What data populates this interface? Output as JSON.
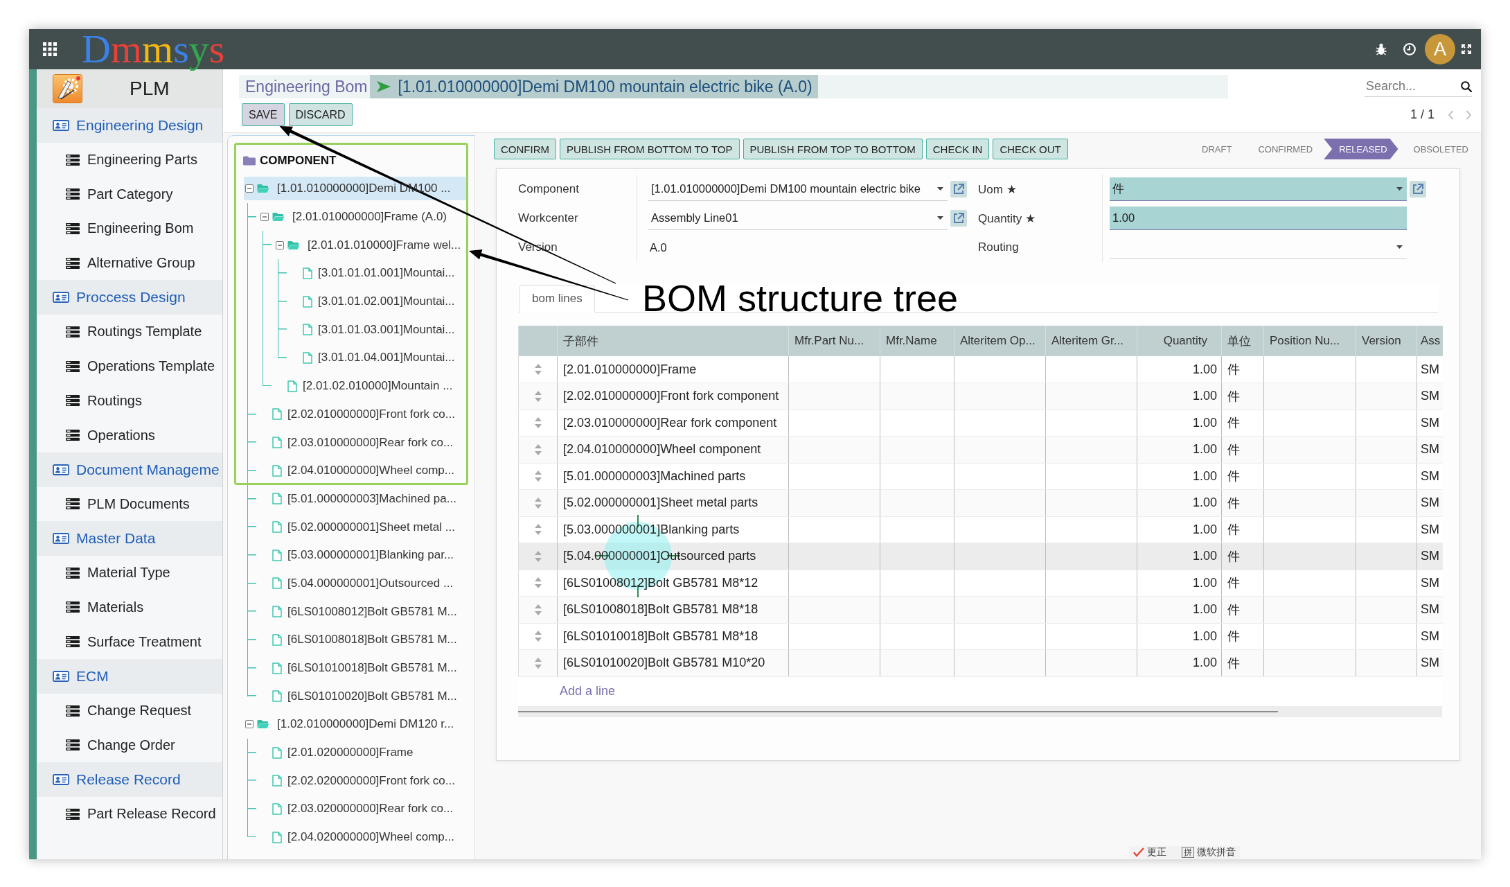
{
  "topbar": {
    "logo": "Dmmsys",
    "avatar": "A"
  },
  "sidebar": {
    "app_title": "PLM",
    "sections": [
      {
        "label": "Engineering Design",
        "children": [
          {
            "label": "Engineering Parts"
          },
          {
            "label": "Part Category"
          },
          {
            "label": "Engineering Bom"
          },
          {
            "label": "Alternative Group"
          }
        ]
      },
      {
        "label": "Proccess Design",
        "children": [
          {
            "label": "Routings Template"
          },
          {
            "label": "Operations Template"
          },
          {
            "label": "Routings"
          },
          {
            "label": "Operations"
          }
        ]
      },
      {
        "label": "Document Manageme",
        "children": [
          {
            "label": "PLM Documents"
          }
        ]
      },
      {
        "label": "Master Data",
        "children": [
          {
            "label": "Material Type"
          },
          {
            "label": "Materials"
          },
          {
            "label": "Surface Treatment"
          }
        ]
      },
      {
        "label": "ECM",
        "children": [
          {
            "label": "Change Request"
          },
          {
            "label": "Change Order"
          }
        ]
      },
      {
        "label": "Release Record",
        "children": [
          {
            "label": "Part Release Record"
          }
        ]
      }
    ]
  },
  "breadcrumb": [
    {
      "label": "Engineering Bom",
      "selected": false
    },
    {
      "label": "[1.01.010000000]Demi DM100 mountain electric bike (A.0)",
      "selected": true
    }
  ],
  "search": {
    "placeholder": "Search..."
  },
  "edit_buttons": [
    {
      "label": "SAVE",
      "kind": "save"
    },
    {
      "label": "DISCARD",
      "kind": "discard"
    }
  ],
  "pager": "1 / 1",
  "tree": {
    "header": "COMPONENT",
    "nodes": [
      {
        "label": "[1.01.010000000]Demi DM100 ...",
        "selected": true,
        "expanded": true,
        "children": [
          {
            "label": "[2.01.010000000]Frame (A.0)",
            "selected": false,
            "expanded": true,
            "children": [
              {
                "label": "[2.01.01.010000]Frame wel...",
                "selected": false,
                "expanded": true,
                "children": [
                  {
                    "label": "[3.01.01.01.001]Mountai...",
                    "selected": false
                  },
                  {
                    "label": "[3.01.01.02.001]Mountai...",
                    "selected": false
                  },
                  {
                    "label": "[3.01.01.03.001]Mountai...",
                    "selected": false
                  },
                  {
                    "label": "[3.01.01.04.001]Mountai...",
                    "selected": false
                  }
                ]
              },
              {
                "label": "[2.01.02.010000]Mountain ...",
                "selected": false
              }
            ]
          },
          {
            "label": "[2.02.010000000]Front fork co...",
            "selected": false
          },
          {
            "label": "[2.03.010000000]Rear fork co...",
            "selected": false
          },
          {
            "label": "[2.04.010000000]Wheel comp...",
            "selected": false
          },
          {
            "label": "[5.01.000000003]Machined pa...",
            "selected": false
          },
          {
            "label": "[5.02.000000001]Sheet metal ...",
            "selected": false
          },
          {
            "label": "[5.03.000000001]Blanking par...",
            "selected": false
          },
          {
            "label": "[5.04.000000001]Outsourced ...",
            "selected": false
          },
          {
            "label": "[6LS01008012]Bolt GB5781 M...",
            "selected": false
          },
          {
            "label": "[6LS01008018]Bolt GB5781 M...",
            "selected": false
          },
          {
            "label": "[6LS01010018]Bolt GB5781 M...",
            "selected": false
          },
          {
            "label": "[6LS01010020]Bolt GB5781 M...",
            "selected": false
          }
        ]
      },
      {
        "label": "[1.02.010000000]Demi DM120 r...",
        "selected": false,
        "expanded": true,
        "children": [
          {
            "label": "[2.01.020000000]Frame",
            "selected": false
          },
          {
            "label": "[2.02.020000000]Front fork co...",
            "selected": false
          },
          {
            "label": "[2.03.020000000]Rear fork co...",
            "selected": false
          },
          {
            "label": "[2.04.020000000]Wheel comp...",
            "selected": false
          }
        ]
      }
    ]
  },
  "action_buttons": [
    "CONFIRM",
    "PUBLISH FROM BOTTOM TO TOP",
    "PUBLISH FROM TOP TO BOTTOM",
    "CHECK IN",
    "CHECK OUT"
  ],
  "status_steps": [
    {
      "label": "DRAFT",
      "selected": false
    },
    {
      "label": "CONFIRMED",
      "selected": false
    },
    {
      "label": "RELEASED",
      "selected": true
    },
    {
      "label": "OBSOLETED",
      "selected": false
    }
  ],
  "form": {
    "field_groups": [
      {
        "fields": [
          {
            "label": "Component",
            "value": "[1.01.010000000]Demi DM100 mountain electric bike",
            "kind": "select",
            "required": false,
            "link": true
          },
          {
            "label": "Workcenter",
            "value": "Assembly Line01",
            "kind": "select",
            "required": false,
            "link": true
          },
          {
            "label": "Version",
            "value": "A.0",
            "kind": "readonly"
          }
        ]
      },
      {
        "fields": [
          {
            "label": "Uom ★",
            "value": "件",
            "kind": "select",
            "required": true,
            "link": true
          },
          {
            "label": "Quantity ★",
            "value": "1.00",
            "kind": "text",
            "required": true,
            "link": false
          },
          {
            "label": "Routing",
            "kind": "select",
            "required": false,
            "link": false
          }
        ]
      }
    ]
  },
  "tabs": [
    {
      "label": "bom lines",
      "selected": true
    }
  ],
  "table": {
    "columns": [
      "子部件",
      "Mfr.Part Nu...",
      "Mfr.Name",
      "Alteritem Op...",
      "Alteritem Gr...",
      "Quantity",
      "单位",
      "Position Nu...",
      "Version",
      "Ass"
    ],
    "rows": [
      {
        "part": "[2.01.010000000]Frame",
        "quantity": "1.00",
        "unit": "件",
        "column_10": "SM",
        "selected": false
      },
      {
        "part": "[2.02.010000000]Front fork component",
        "quantity": "1.00",
        "unit": "件",
        "column_10": "SM",
        "selected": false
      },
      {
        "part": "[2.03.010000000]Rear fork component",
        "quantity": "1.00",
        "unit": "件",
        "column_10": "SM",
        "selected": false
      },
      {
        "part": "[2.04.010000000]Wheel component",
        "quantity": "1.00",
        "unit": "件",
        "column_10": "SM",
        "selected": false
      },
      {
        "part": "[5.01.000000003]Machined parts",
        "quantity": "1.00",
        "unit": "件",
        "column_10": "SM",
        "selected": false
      },
      {
        "part": "[5.02.000000001]Sheet metal parts",
        "quantity": "1.00",
        "unit": "件",
        "column_10": "SM",
        "selected": false
      },
      {
        "part": "[5.03.000000001]Blanking parts",
        "quantity": "1.00",
        "unit": "件",
        "column_10": "SM",
        "selected": false
      },
      {
        "part": "[5.04.000000001]Outsourced parts",
        "quantity": "1.00",
        "unit": "件",
        "column_10": "SM",
        "selected": true
      },
      {
        "part": "[6LS01008012]Bolt GB5781 M8*12",
        "quantity": "1.00",
        "unit": "件",
        "column_10": "SM",
        "selected": false
      },
      {
        "part": "[6LS01008018]Bolt GB5781 M8*18",
        "quantity": "1.00",
        "unit": "件",
        "column_10": "SM",
        "selected": false
      },
      {
        "part": "[6LS01010018]Bolt GB5781 M8*18",
        "quantity": "1.00",
        "unit": "件",
        "column_10": "SM",
        "selected": false
      },
      {
        "part": "[6LS01010020]Bolt GB5781 M10*20",
        "quantity": "1.00",
        "unit": "件",
        "column_10": "SM",
        "selected": false
      }
    ]
  },
  "add_line": "Add a line",
  "annotation": {
    "text": "BOM structure tree"
  },
  "ime_bar": [
    {
      "kind": "correction",
      "label": "更正"
    },
    {
      "kind": "input_method",
      "badge": "拼",
      "label": "微软拼音"
    }
  ]
}
